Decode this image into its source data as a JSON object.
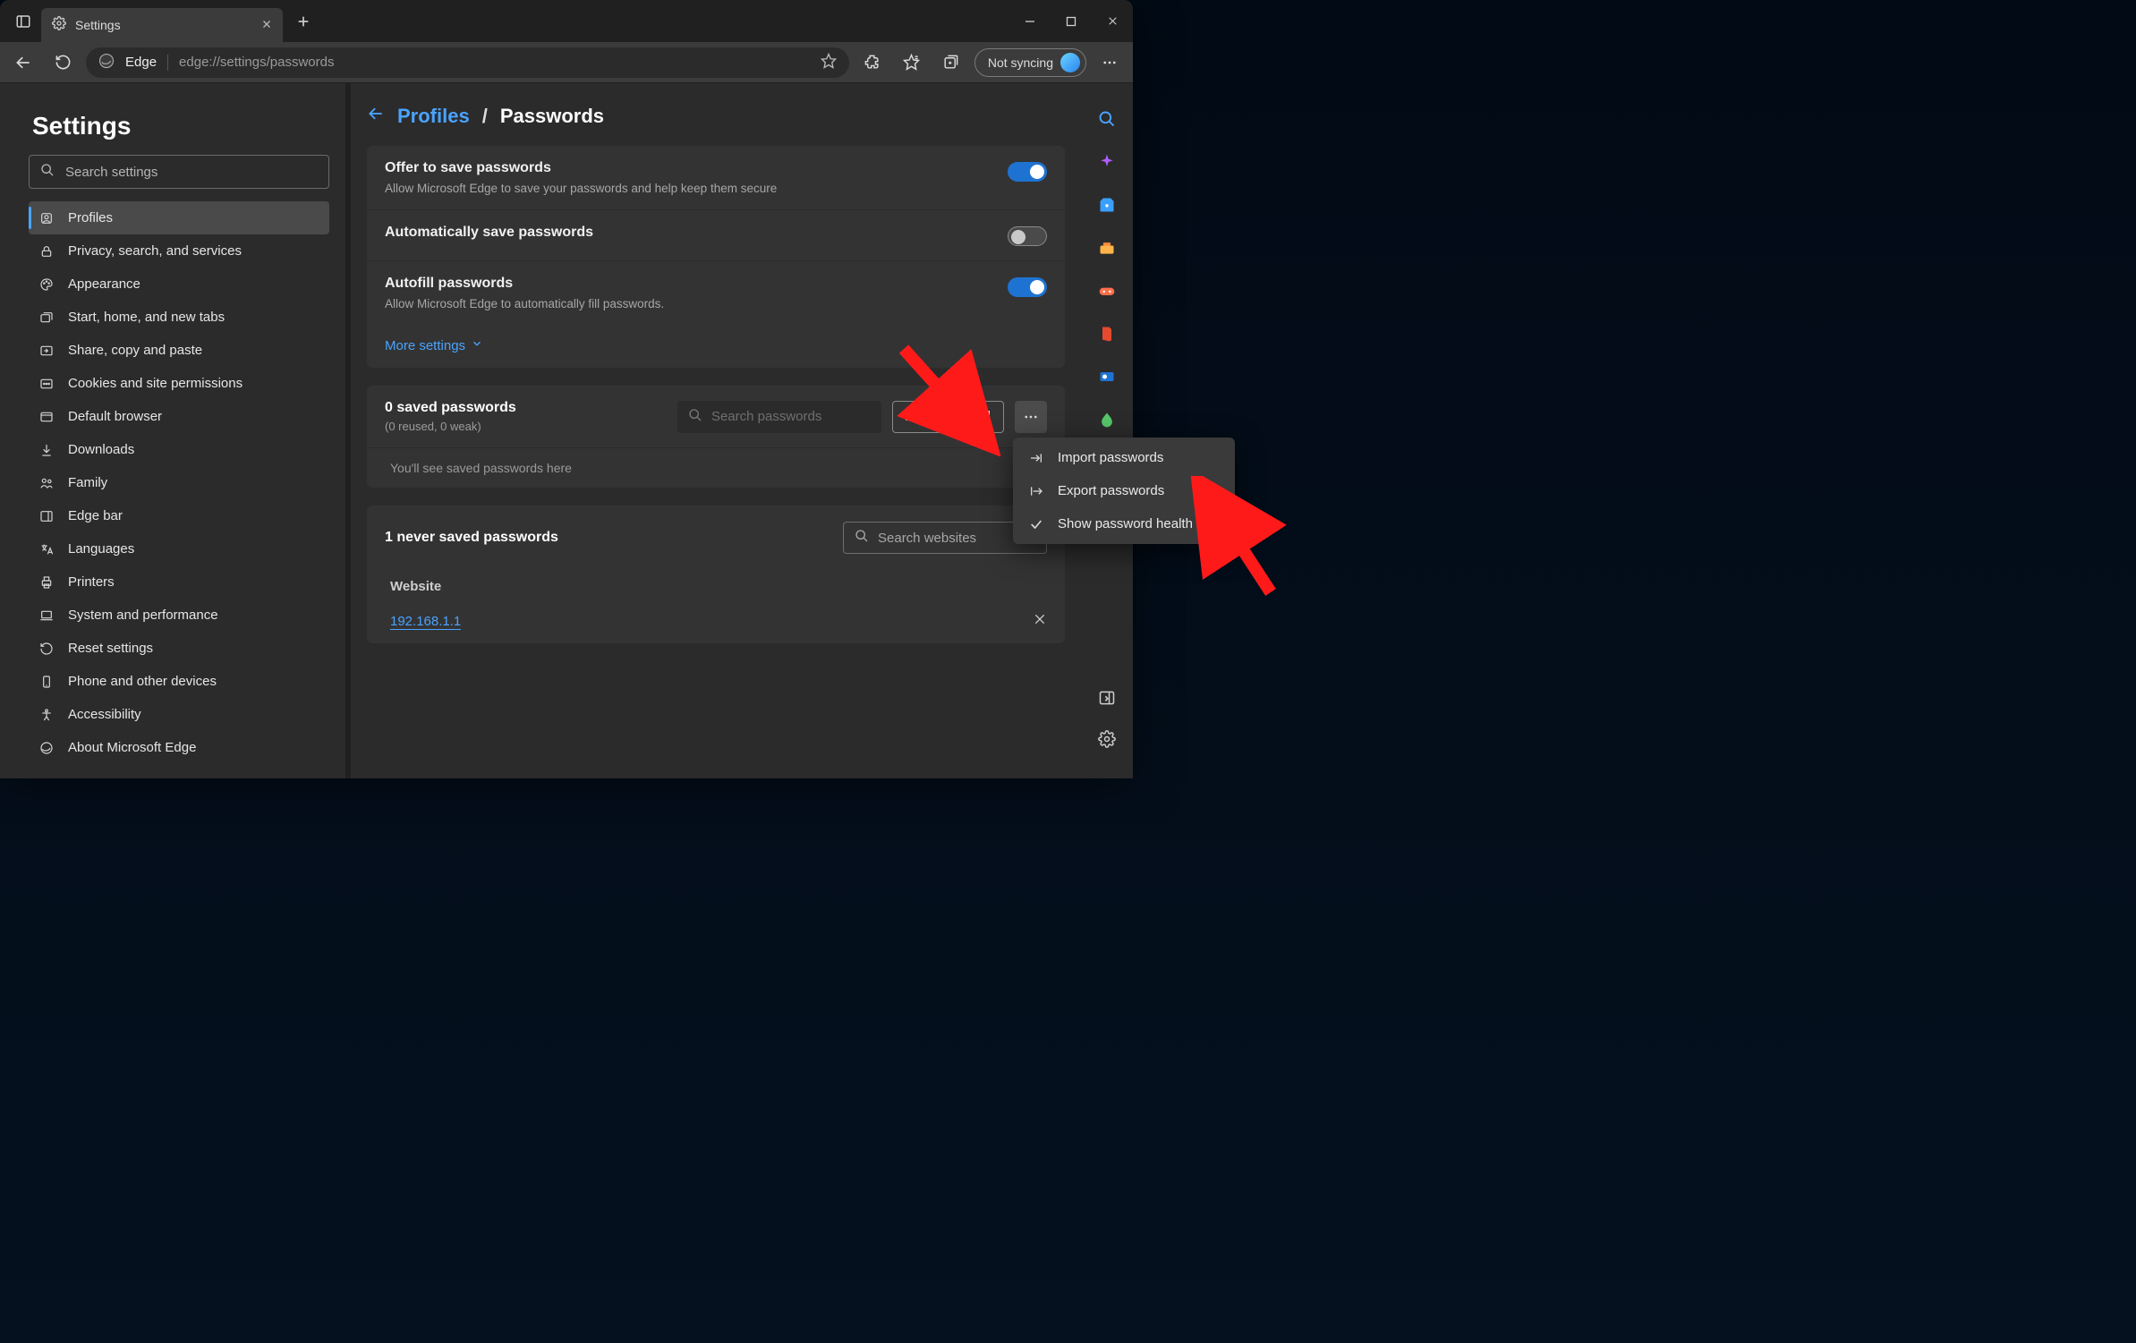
{
  "tab": {
    "title": "Settings"
  },
  "addressbar": {
    "origin": "Edge",
    "url": "edge://settings/passwords"
  },
  "sync": {
    "label": "Not syncing"
  },
  "settings_header": "Settings",
  "search_settings_placeholder": "Search settings",
  "nav": [
    "Profiles",
    "Privacy, search, and services",
    "Appearance",
    "Start, home, and new tabs",
    "Share, copy and paste",
    "Cookies and site permissions",
    "Default browser",
    "Downloads",
    "Family",
    "Edge bar",
    "Languages",
    "Printers",
    "System and performance",
    "Reset settings",
    "Phone and other devices",
    "Accessibility",
    "About Microsoft Edge"
  ],
  "breadcrumb": {
    "parent": "Profiles",
    "sep": "/",
    "current": "Passwords"
  },
  "card1": {
    "r1_title": "Offer to save passwords",
    "r1_desc": "Allow Microsoft Edge to save your passwords and help keep them secure",
    "r2_title": "Automatically save passwords",
    "r3_title": "Autofill passwords",
    "r3_desc": "Allow Microsoft Edge to automatically fill passwords.",
    "more": "More settings"
  },
  "saved": {
    "title": "0 saved passwords",
    "sub": "(0 reused, 0 weak)",
    "search_placeholder": "Search passwords",
    "add_btn": "Add password",
    "empty": "You'll see saved passwords here"
  },
  "never": {
    "title": "1 never saved passwords",
    "search_placeholder": "Search websites",
    "col": "Website",
    "rows": [
      "192.168.1.1"
    ]
  },
  "ctx": {
    "import": "Import passwords",
    "export": "Export passwords",
    "show": "Show password health"
  }
}
